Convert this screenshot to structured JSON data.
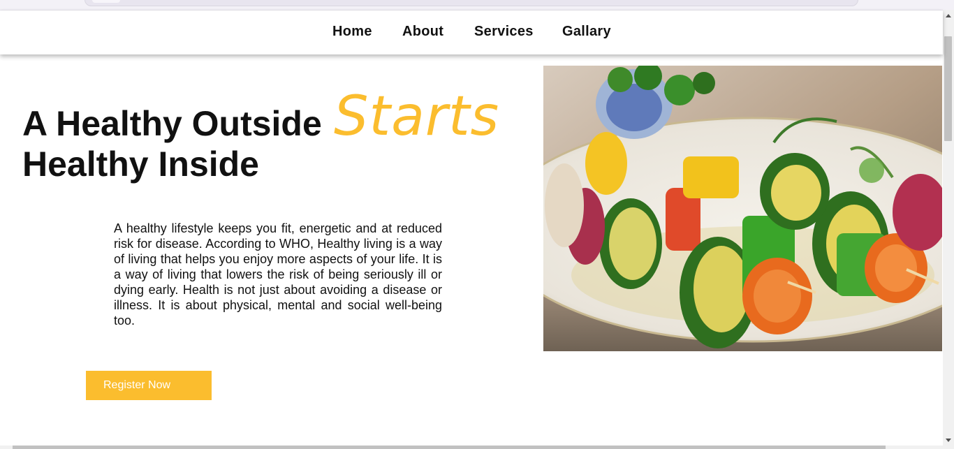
{
  "nav": {
    "items": [
      {
        "label": "Home"
      },
      {
        "label": "About"
      },
      {
        "label": "Services"
      },
      {
        "label": "Gallary"
      }
    ]
  },
  "hero": {
    "title_line1": "A Healthy Outside",
    "title_accent": "Starts",
    "title_line2": "Healthy Inside",
    "paragraph": "A healthy lifestyle keeps you fit, energetic and at reduced risk for disease. According to WHO, Healthy living is a way of living that helps you enjoy more aspects of your life. It is a way of living that lowers the risk of being seriously ill or dying early. Health is not just about avoiding a disease or illness. It is about physical, mental and social well-being too.",
    "button_label": "Register Now"
  },
  "colors": {
    "accent": "#fbbd2e",
    "text": "#111111",
    "background": "#ffffff"
  }
}
